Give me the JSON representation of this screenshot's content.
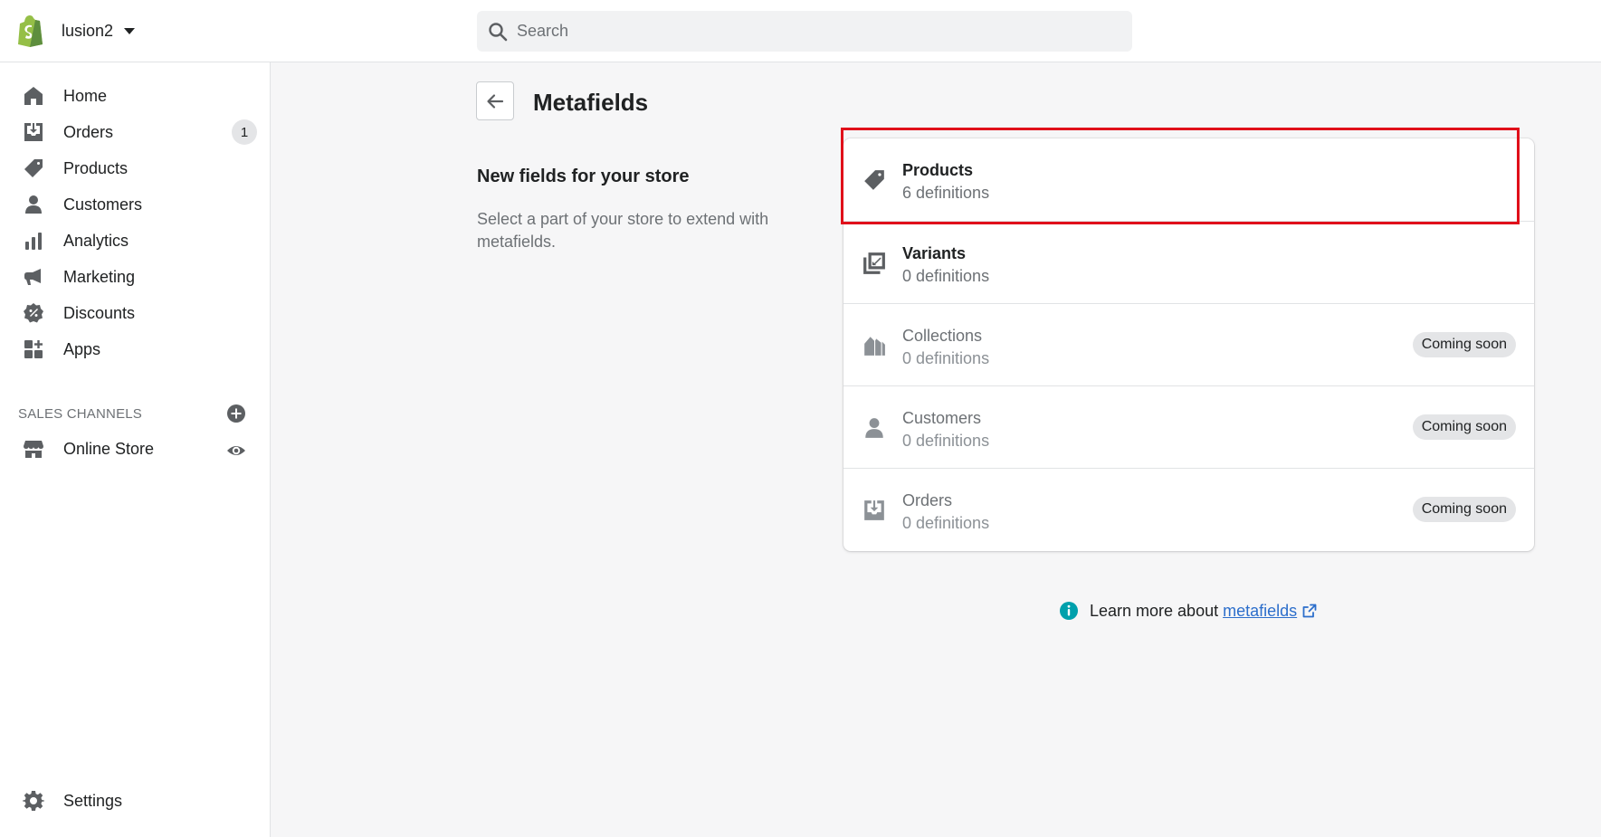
{
  "header": {
    "store_name": "lusion2",
    "search_placeholder": "Search"
  },
  "sidebar": {
    "items": [
      {
        "label": "Home",
        "icon": "home-icon"
      },
      {
        "label": "Orders",
        "icon": "orders-icon",
        "badge": "1"
      },
      {
        "label": "Products",
        "icon": "tag-icon"
      },
      {
        "label": "Customers",
        "icon": "customer-icon"
      },
      {
        "label": "Analytics",
        "icon": "analytics-icon"
      },
      {
        "label": "Marketing",
        "icon": "megaphone-icon"
      },
      {
        "label": "Discounts",
        "icon": "discount-icon"
      },
      {
        "label": "Apps",
        "icon": "apps-icon"
      }
    ],
    "sales_channels_heading": "SALES CHANNELS",
    "online_store_label": "Online Store",
    "settings_label": "Settings"
  },
  "page": {
    "title": "Metafields",
    "section_title": "New fields for your store",
    "section_description": "Select a part of your store to extend with metafields."
  },
  "resources": [
    {
      "title": "Products",
      "subtitle": "6 definitions",
      "status": "",
      "icon": "tag-icon"
    },
    {
      "title": "Variants",
      "subtitle": "0 definitions",
      "status": "",
      "icon": "variants-icon"
    },
    {
      "title": "Collections",
      "subtitle": "0 definitions",
      "status": "Coming soon",
      "icon": "collections-icon"
    },
    {
      "title": "Customers",
      "subtitle": "0 definitions",
      "status": "Coming soon",
      "icon": "customer-icon"
    },
    {
      "title": "Orders",
      "subtitle": "0 definitions",
      "status": "Coming soon",
      "icon": "orders-icon"
    }
  ],
  "learn_more": {
    "prefix": "Learn more about",
    "link_text": "metafields"
  },
  "colors": {
    "highlight": "#e0101a",
    "link": "#2c6ecb",
    "info": "#00a0ac",
    "brand": "#95bf47"
  }
}
